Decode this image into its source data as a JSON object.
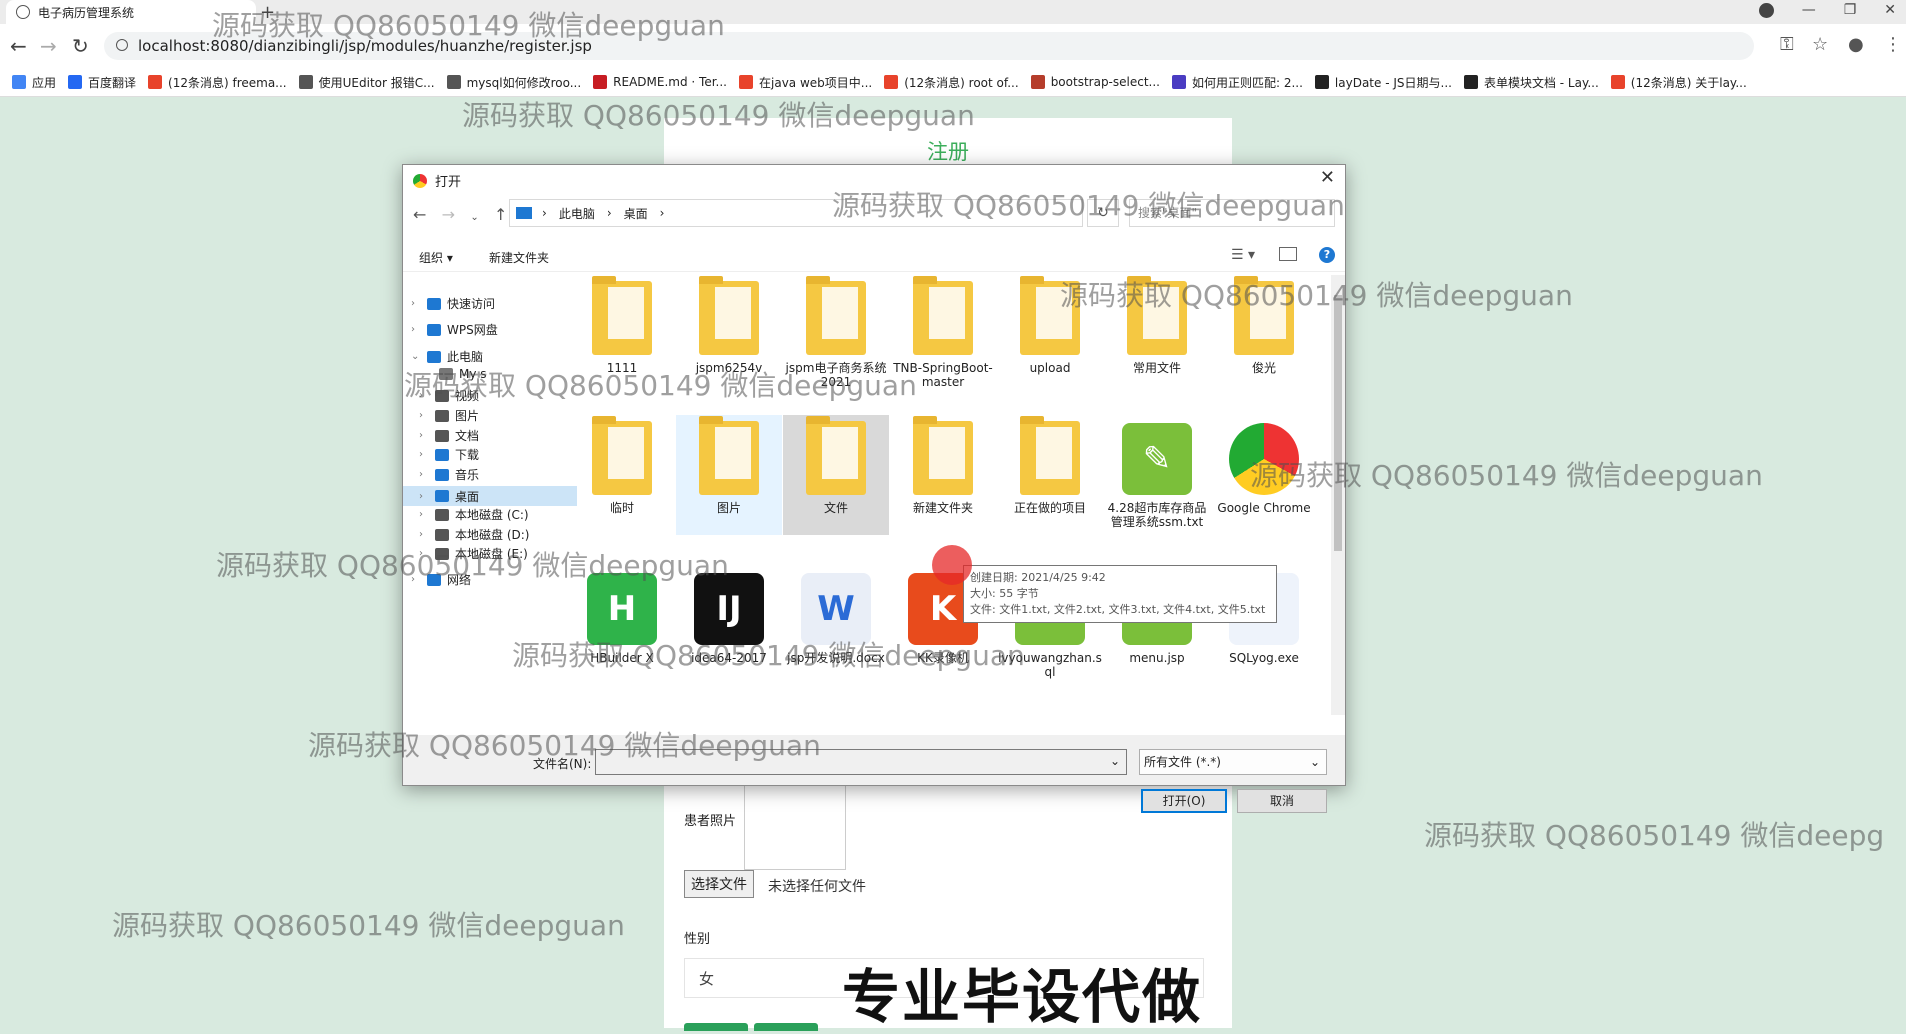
{
  "browser": {
    "tab_title": "电子病历管理系统",
    "url": "localhost:8080/dianzibingli/jsp/modules/huanzhe/register.jsp",
    "bookmarks": [
      {
        "label": "应用",
        "color": "#4285f4"
      },
      {
        "label": "百度翻译",
        "color": "#2468f2"
      },
      {
        "label": "(12条消息) freema...",
        "color": "#e8432b"
      },
      {
        "label": "使用UEditor 报错C...",
        "color": "#555555"
      },
      {
        "label": "mysql如何修改roo...",
        "color": "#555555"
      },
      {
        "label": "README.md · Ter...",
        "color": "#c71d23"
      },
      {
        "label": "在java web项目中...",
        "color": "#e8432b"
      },
      {
        "label": "(12条消息) root of...",
        "color": "#e8432b"
      },
      {
        "label": "bootstrap-select...",
        "color": "#b53d2b"
      },
      {
        "label": "如何用正则匹配: 2...",
        "color": "#4a3cc2"
      },
      {
        "label": "layDate - JS日期与...",
        "color": "#222222"
      },
      {
        "label": "表单模块文档 - Lay...",
        "color": "#222222"
      },
      {
        "label": "(12条消息) 关于lay...",
        "color": "#e8432b"
      }
    ]
  },
  "page": {
    "title": "注册",
    "photo_label": "患者照片",
    "choose_file": "选择文件",
    "no_file": "未选择任何文件",
    "sex_label": "性别",
    "sex_value": "女",
    "overlay_text": "专业毕设代做"
  },
  "watermark": "源码获取 QQ86050149 微信deepguan",
  "watermark_cut": "源码获取 QQ86050149 微信deepg",
  "dialog": {
    "title": "打开",
    "path": [
      "此电脑",
      "桌面"
    ],
    "search_placeholder": "搜索\"桌面\"",
    "organize": "组织 ▾",
    "new_folder": "新建文件夹",
    "tree": [
      {
        "label": "快速访问",
        "color": "#1e78d2"
      },
      {
        "label": "WPS网盘",
        "color": "#1e78d2"
      },
      {
        "label": "此电脑",
        "color": "#1e78d2"
      },
      {
        "label": "My s",
        "color": "#777777"
      },
      {
        "label": "视频",
        "color": "#555555"
      },
      {
        "label": "图片",
        "color": "#555555"
      },
      {
        "label": "文档",
        "color": "#555555"
      },
      {
        "label": "下载",
        "color": "#1e78d2"
      },
      {
        "label": "音乐",
        "color": "#1e78d2"
      },
      {
        "label": "桌面",
        "color": "#1e78d2"
      },
      {
        "label": "本地磁盘 (C:)",
        "color": "#555555"
      },
      {
        "label": "本地磁盘 (D:)",
        "color": "#555555"
      },
      {
        "label": "本地磁盘 (E:)",
        "color": "#555555"
      },
      {
        "label": "网络",
        "color": "#1e78d2"
      }
    ],
    "files": [
      {
        "label": "1111",
        "kind": "folder"
      },
      {
        "label": "jspm6254v",
        "kind": "folder"
      },
      {
        "label": "jspm电子商务系统2021",
        "kind": "folder"
      },
      {
        "label": "TNB-SpringBoot-master",
        "kind": "folder"
      },
      {
        "label": "upload",
        "kind": "folder"
      },
      {
        "label": "常用文件",
        "kind": "folder"
      },
      {
        "label": "俊光",
        "kind": "folder"
      },
      {
        "label": "临时",
        "kind": "folder"
      },
      {
        "label": "图片",
        "kind": "folder"
      },
      {
        "label": "文件",
        "kind": "folder"
      },
      {
        "label": "新建文件夹",
        "kind": "folder"
      },
      {
        "label": "正在做的项目",
        "kind": "folder"
      },
      {
        "label": "4.28超市库存商品管理系统ssm.txt",
        "kind": "notepad"
      },
      {
        "label": "Google Chrome",
        "kind": "chrome"
      },
      {
        "label": "HBuilder X",
        "kind": "hbuilder"
      },
      {
        "label": "idea64-2017",
        "kind": "idea"
      },
      {
        "label": "jsp开发说明.docx",
        "kind": "word"
      },
      {
        "label": "KK录像机",
        "kind": "kk"
      },
      {
        "label": "lvyouwangzhan.sql",
        "kind": "notepad"
      },
      {
        "label": "menu.jsp",
        "kind": "notepad"
      },
      {
        "label": "SQLyog.exe",
        "kind": "sqlyog"
      }
    ],
    "tooltip": {
      "created": "创建日期: 2021/4/25 9:42",
      "size": "大小: 55 字节",
      "files": "文件: 文件1.txt, 文件2.txt, 文件3.txt, 文件4.txt, 文件5.txt"
    },
    "filename_label": "文件名(N):",
    "filetype": "所有文件 (*.*)",
    "open_btn": "打开(O)",
    "cancel_btn": "取消"
  }
}
